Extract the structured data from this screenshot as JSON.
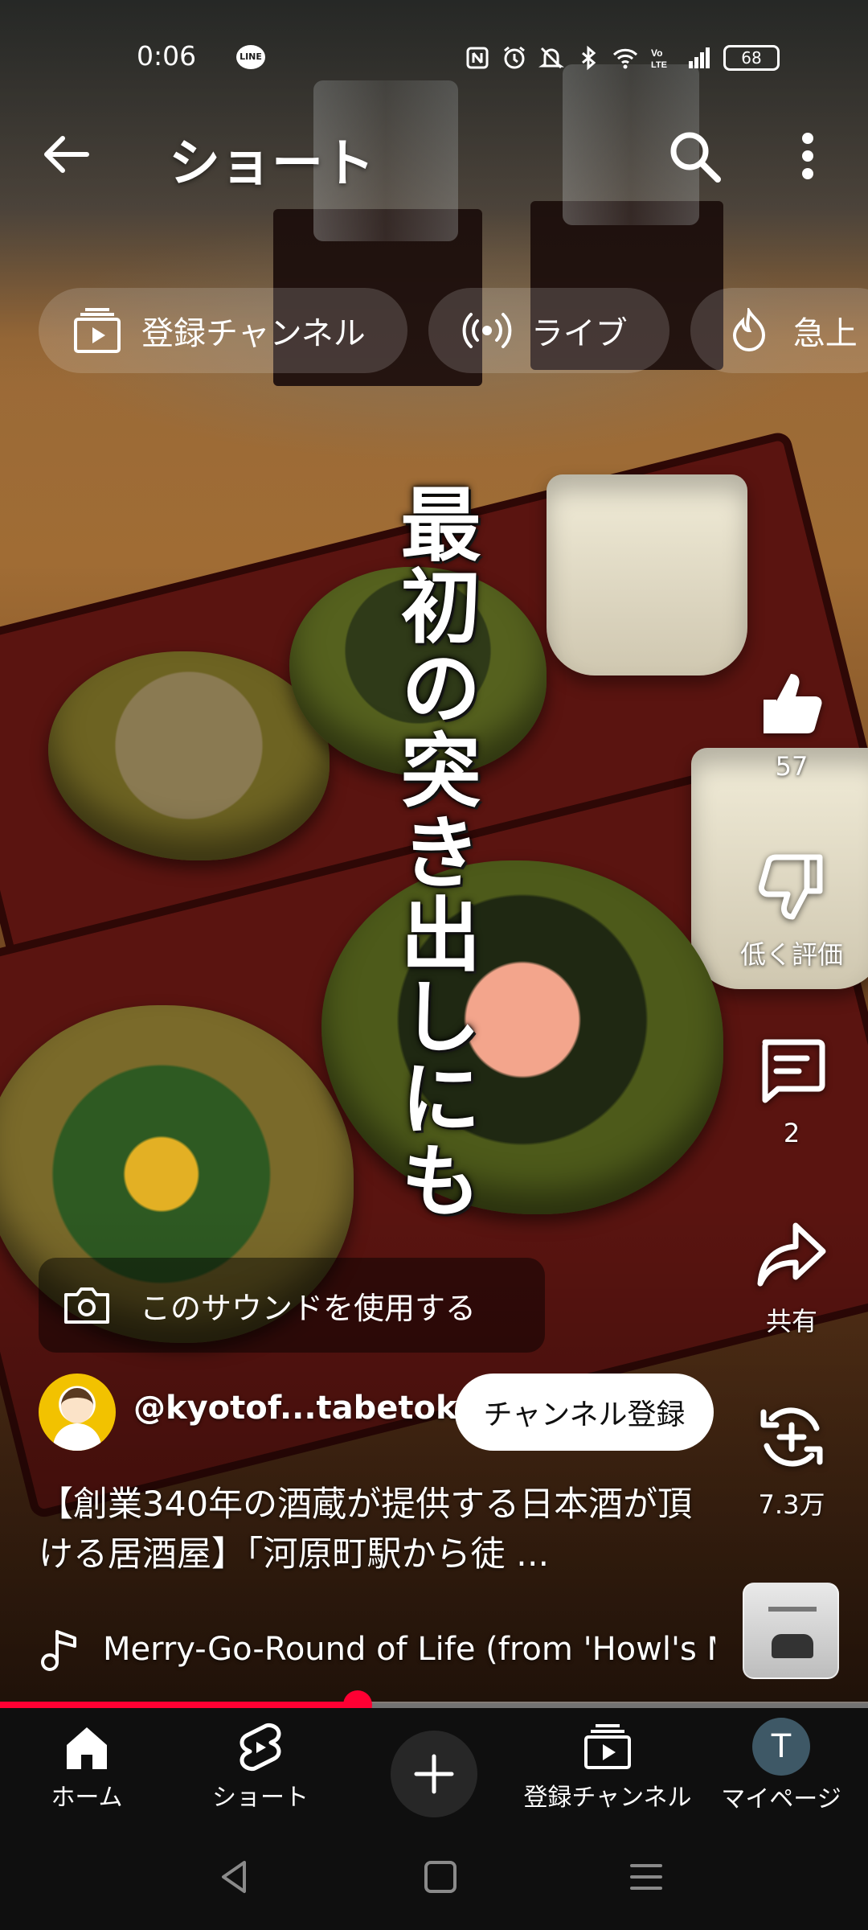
{
  "status_bar": {
    "time": "0:06",
    "line_label": "LINE",
    "icons": [
      "nfc-icon",
      "alarm-icon",
      "mute-icon",
      "bluetooth-icon",
      "wifi-icon",
      "volte-icon",
      "signal-icon"
    ],
    "battery": "68"
  },
  "header": {
    "title": "ショート"
  },
  "chips": [
    {
      "label": "登録チャンネル",
      "icon": "subscriptions-icon"
    },
    {
      "label": "ライブ",
      "icon": "live-icon"
    },
    {
      "label": "急上",
      "icon": "trending-icon"
    }
  ],
  "video": {
    "overlay_caption": "最初の突き出しにも",
    "progress_fraction": 0.412
  },
  "actions": {
    "like_count": "57",
    "dislike_label": "低く評価",
    "comment_count": "2",
    "share_label": "共有",
    "remix_count": "7.3万"
  },
  "sound_pill": {
    "label": "このサウンドを使用する"
  },
  "channel": {
    "handle": "@kyotof...tabetoku",
    "subscribe_label": "チャンネル登録"
  },
  "description": {
    "title": "【創業340年の酒蔵が提供する日本酒が頂ける居酒屋】「河原町駅から徒 ..."
  },
  "music": {
    "track": "Merry-Go-Round of Life (from 'Howl's Mov"
  },
  "bottom_nav": {
    "home": "ホーム",
    "shorts": "ショート",
    "subscriptions": "登録チャンネル",
    "mypage": "マイページ",
    "avatar_letter": "T"
  },
  "colors": {
    "accent": "#ff0033",
    "nav_bg": "#0f0f0f",
    "avatar_bg": "#3e5866"
  }
}
